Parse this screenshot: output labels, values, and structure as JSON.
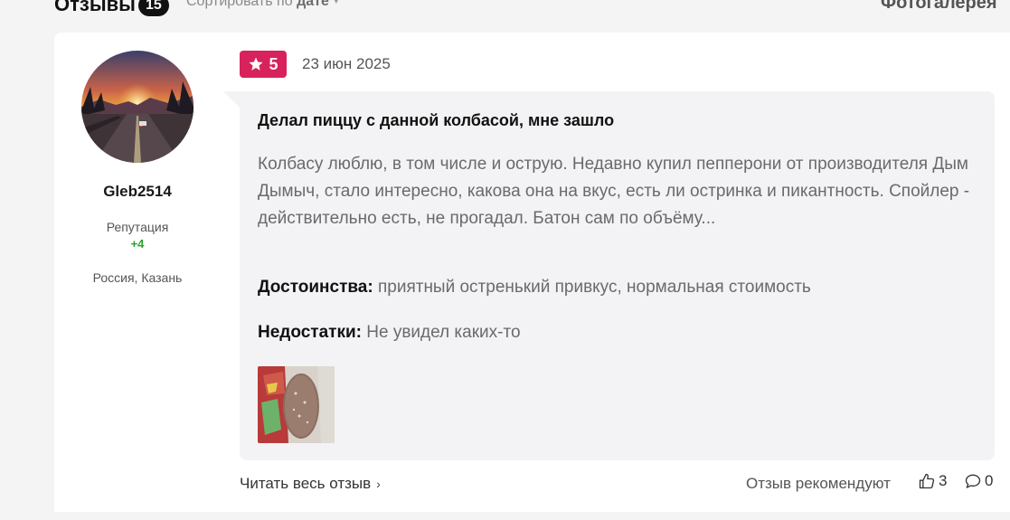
{
  "header": {
    "reviews_title": "Отзывы",
    "reviews_count": "15",
    "sort_prefix": "Сортировать по",
    "sort_value": "дате",
    "photogallery_label": "Фотогалерея"
  },
  "author": {
    "username": "Gleb2514",
    "reputation_label": "Репутация",
    "reputation_value": "+4",
    "location": "Россия, Казань",
    "avatar_icon": "road-sunset-avatar"
  },
  "review": {
    "rating": "5",
    "date": "23 июн 2025",
    "title": "Делал пиццу с данной колбасой, мне зашло",
    "text": "Колбасу люблю, в том числе и острую. Недавно купил пепперони от производителя Дым Дымыч, стало интересно, какова она на вкус, есть ли остринка и пикантность. Спойлер - действительно есть, не прогадал. Батон сам по объёму...",
    "pros_label": "Достоинства:",
    "pros": "приятный остренький привкус, нормальная стоимость",
    "cons_label": "Недостатки:",
    "cons": "Не увидел каких-то",
    "photo_icon": "sausage-photo-thumbnail"
  },
  "footer": {
    "read_more": "Читать весь отзыв",
    "recommend_label": "Отзыв рекомендуют",
    "likes": "3",
    "comments": "0"
  },
  "colors": {
    "rating_badge": "#d8225c",
    "reputation_positive": "#2aa32a",
    "bubble_bg": "#f3f3f5"
  }
}
